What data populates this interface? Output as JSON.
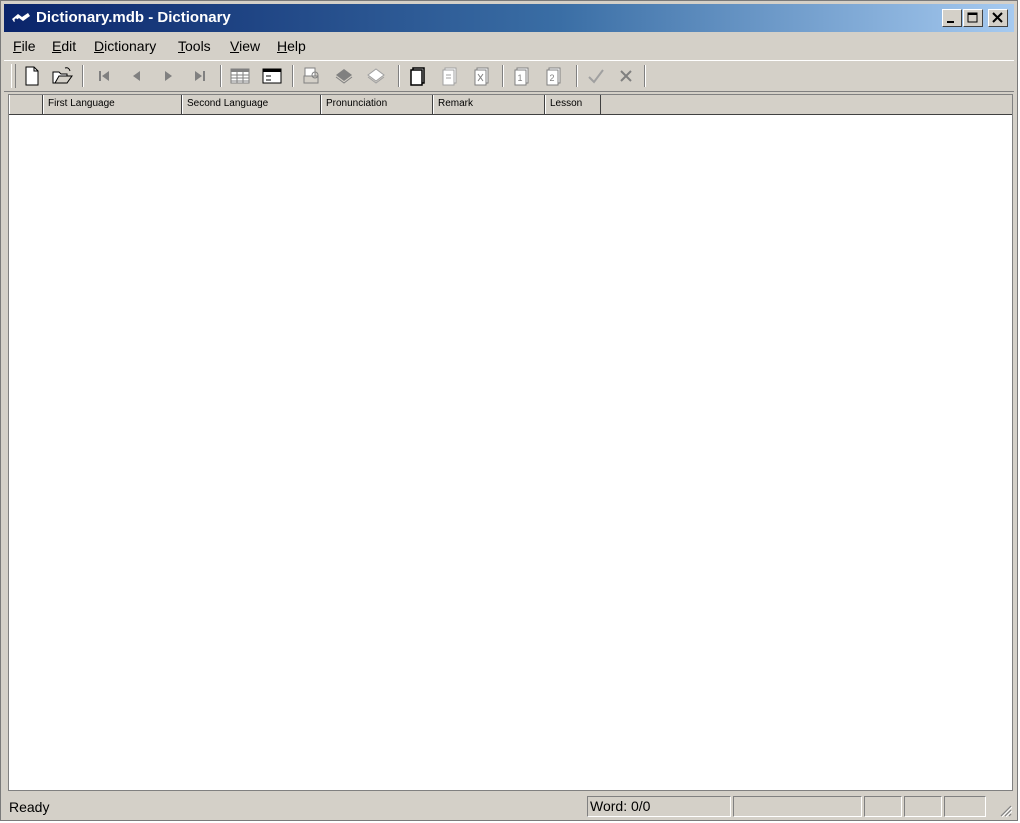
{
  "window": {
    "title": "Dictionary.mdb - Dictionary",
    "controls": {
      "minimize": "minimize",
      "maximize": "maximize",
      "close": "close"
    }
  },
  "menu": [
    {
      "first": "F",
      "rest": "ile"
    },
    {
      "first": "E",
      "rest": "dit"
    },
    {
      "first": "D",
      "rest": "ictionary"
    },
    {
      "first": "T",
      "rest": "ools"
    },
    {
      "first": "V",
      "rest": "iew"
    },
    {
      "first": "H",
      "rest": "elp"
    }
  ],
  "toolbar": {
    "buttons": [
      "new-icon",
      "open-icon",
      "first-record-icon",
      "previous-record-icon",
      "next-record-icon",
      "last-record-icon",
      "table-view-icon",
      "form-view-icon",
      "print-preview-icon",
      "lesson-fill-icon",
      "lesson-outline-icon",
      "new-card-icon",
      "edit-card-icon",
      "delete-card-icon",
      "test-1-icon",
      "test-2-icon",
      "confirm-icon",
      "cancel-icon"
    ]
  },
  "grid": {
    "columns": [
      "First Language",
      "Second Language",
      "Pronunciation",
      "Remark",
      "Lesson"
    ]
  },
  "status": {
    "text": "Ready",
    "word_count": "Word: 0/0"
  },
  "colors": {
    "title_gradient_start": "#0a246a",
    "title_gradient_end": "#a6caf0",
    "chrome": "#d4d0c8"
  }
}
